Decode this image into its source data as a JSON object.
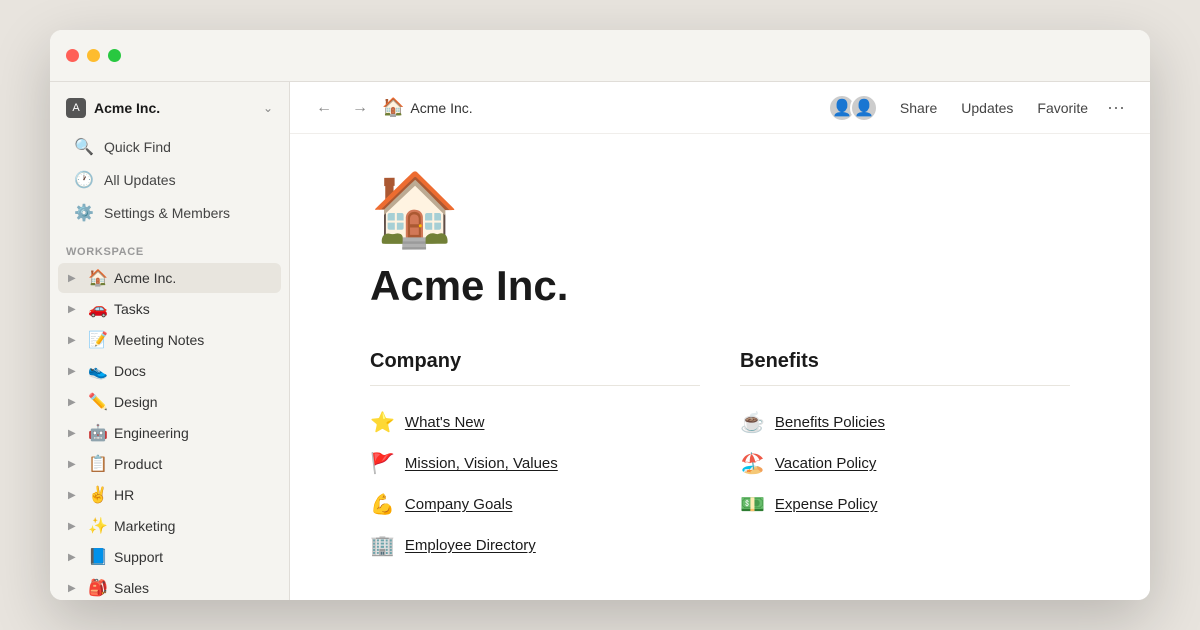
{
  "window": {
    "title": "Acme Inc."
  },
  "sidebar": {
    "workspace_name": "Acme Inc.",
    "nav_items": [
      {
        "id": "quick-find",
        "icon": "🔍",
        "label": "Quick Find"
      },
      {
        "id": "all-updates",
        "icon": "🕐",
        "label": "All Updates"
      },
      {
        "id": "settings",
        "icon": "⚙️",
        "label": "Settings & Members"
      }
    ],
    "section_label": "WORKSPACE",
    "tree_items": [
      {
        "id": "acme-inc",
        "emoji": "🏠",
        "label": "Acme Inc.",
        "active": true
      },
      {
        "id": "tasks",
        "emoji": "🚗",
        "label": "Tasks",
        "active": false
      },
      {
        "id": "meeting-notes",
        "emoji": "📝",
        "label": "Meeting Notes",
        "active": false
      },
      {
        "id": "docs",
        "emoji": "👟",
        "label": "Docs",
        "active": false
      },
      {
        "id": "design",
        "emoji": "✏️",
        "label": "Design",
        "active": false
      },
      {
        "id": "engineering",
        "emoji": "🤖",
        "label": "Engineering",
        "active": false
      },
      {
        "id": "product",
        "emoji": "📋",
        "label": "Product",
        "active": false
      },
      {
        "id": "hr",
        "emoji": "✌️",
        "label": "HR",
        "active": false
      },
      {
        "id": "marketing",
        "emoji": "✨",
        "label": "Marketing",
        "active": false
      },
      {
        "id": "support",
        "emoji": "📘",
        "label": "Support",
        "active": false
      },
      {
        "id": "sales",
        "emoji": "🎒",
        "label": "Sales",
        "active": false
      }
    ]
  },
  "topbar": {
    "path_emoji": "🏠",
    "path_name": "Acme Inc.",
    "back_label": "←",
    "forward_label": "→",
    "share_label": "Share",
    "updates_label": "Updates",
    "favorite_label": "Favorite",
    "more_label": "···",
    "avatars": [
      "👤",
      "👤"
    ]
  },
  "page": {
    "icon": "🏠",
    "title": "Acme Inc.",
    "columns": [
      {
        "id": "company",
        "title": "Company",
        "links": [
          {
            "emoji": "⭐",
            "text": "What's New"
          },
          {
            "emoji": "🚩",
            "text": "Mission, Vision, Values"
          },
          {
            "emoji": "💪",
            "text": "Company Goals"
          },
          {
            "emoji": "🏢",
            "text": "Employee Directory"
          }
        ]
      },
      {
        "id": "benefits",
        "title": "Benefits",
        "links": [
          {
            "emoji": "☕",
            "text": "Benefits Policies"
          },
          {
            "emoji": "🏖️",
            "text": "Vacation Policy"
          },
          {
            "emoji": "💵",
            "text": "Expense Policy"
          }
        ]
      }
    ]
  }
}
